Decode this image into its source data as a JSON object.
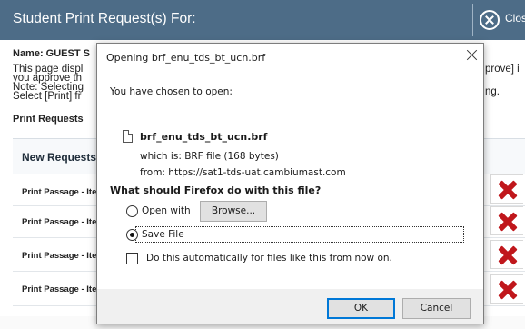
{
  "header": {
    "title": "Student Print Request(s) For:",
    "close_label": "Close"
  },
  "page": {
    "name_label": "Name: GUEST S",
    "desc_line1": "This page displ",
    "desc_line1_end": "prove] i",
    "desc_line2": "you approve th",
    "desc_line3": "Note: Selecting",
    "desc_line3_end": "ng.",
    "desc_line4": "Select [Print] fr",
    "print_requests_label": "Print Requests",
    "new_requests_label": "New Requests",
    "rows": [
      {
        "label": "Print Passage - Ite"
      },
      {
        "label": "Print Passage - Ite"
      },
      {
        "label": "Print Passage - Ite"
      },
      {
        "label": "Print Passage - Ite"
      }
    ]
  },
  "dialog": {
    "title": "Opening brf_enu_tds_bt_ucn.brf",
    "chosen_text": "You have chosen to open:",
    "file_name": "brf_enu_tds_bt_ucn.brf",
    "which_is": "which is: BRF file (168 bytes)",
    "from": "from: https://sat1-tds-uat.cambiumast.com",
    "question": "What should Firefox do with this file?",
    "open_with_label": "Open with",
    "browse_label": "Browse...",
    "save_file_label": "Save File",
    "auto_label": "Do this automatically for files like this from now on.",
    "ok_label": "OK",
    "cancel_label": "Cancel",
    "selected_option": "save_file"
  },
  "colors": {
    "header_bg": "#4d6c87",
    "delete_icon": "#c0171c",
    "primary_button_border": "#0078d7"
  },
  "icons": [
    "close-circle-icon",
    "file-icon",
    "delete-x-icon",
    "dialog-close-icon"
  ]
}
